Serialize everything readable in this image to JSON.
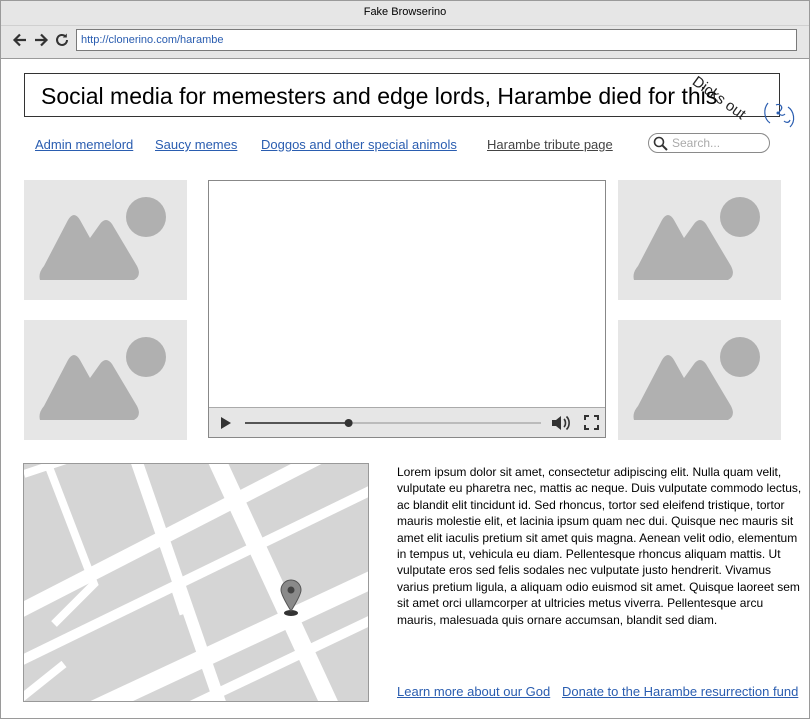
{
  "browser": {
    "window_title": "Fake Browserino",
    "url": "http://clonerino.com/harambe"
  },
  "header": {
    "headline": "Social media for memesters and edge lords, Harambe died for this",
    "annotation": "Dicks out"
  },
  "nav": {
    "items": [
      {
        "label": "Admin memelord"
      },
      {
        "label": "Saucy memes"
      },
      {
        "label": "Doggos and other special animols"
      },
      {
        "label": "Harambe tribute page"
      }
    ],
    "search_placeholder": "Search..."
  },
  "video": {
    "progress": 0.35
  },
  "article": {
    "text": "Lorem ipsum dolor sit amet, consectetur adipiscing elit. Nulla quam velit, vulputate eu pharetra nec, mattis ac neque. Duis vulputate commodo lectus, ac blandit elit tincidunt id. Sed rhoncus, tortor sed eleifend tristique, tortor mauris molestie elit, et lacinia ipsum quam nec dui. Quisque nec mauris sit amet elit iaculis pretium sit amet quis magna. Aenean velit odio, elementum in tempus ut, vehicula eu diam. Pellentesque rhoncus aliquam mattis. Ut vulputate eros sed felis sodales nec vulputate justo hendrerit. Vivamus varius pretium ligula, a aliquam odio euismod sit amet. Quisque laoreet sem sit amet orci ullamcorper at ultricies metus viverra. Pellentesque arcu mauris, malesuada quis ornare accumsan, blandit sed diam."
  },
  "footer_links": {
    "learn_more": "Learn more about our God",
    "donate": "Donate to the Harambe resurrection fund"
  },
  "colors": {
    "link": "#2a5db0",
    "placeholder_bg": "#e6e6e6",
    "placeholder_fg": "#b0b0b0"
  }
}
